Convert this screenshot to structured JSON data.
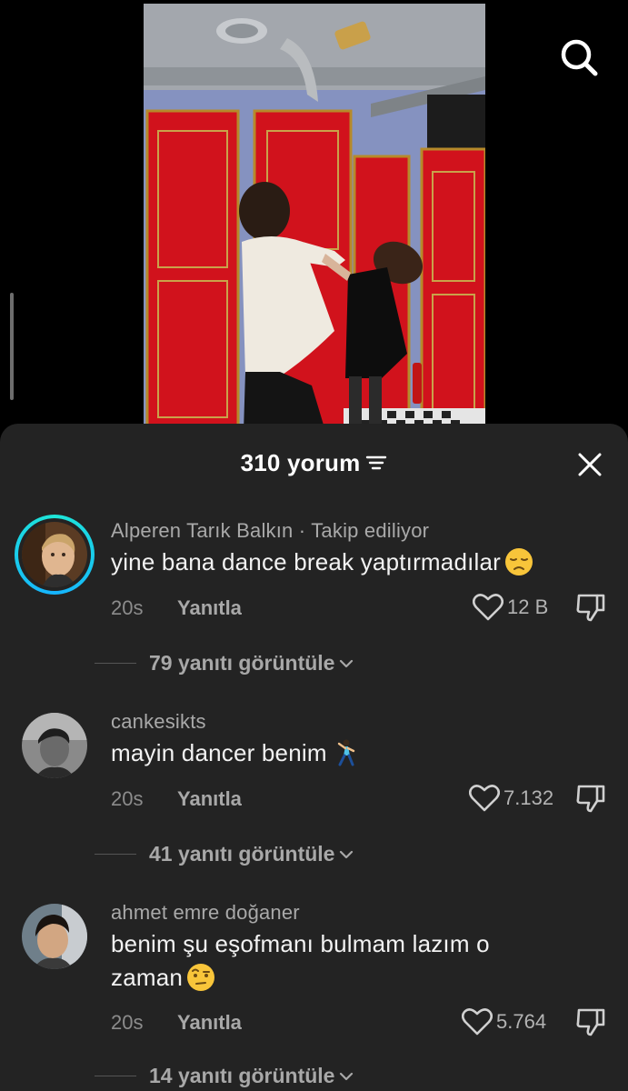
{
  "header": {
    "comment_count": "310 yorum"
  },
  "comments": [
    {
      "username": "Alperen Tarık Balkın · Takip ediliyor",
      "text": "yine bana dance break yaptırmadılar",
      "emoji": "pensive-face-emoji",
      "time": "20s",
      "reply": "Yanıtla",
      "likes": "12 B",
      "view_replies": "79 yanıtı görüntüle"
    },
    {
      "username": "cankesikts",
      "text": "mayin dancer benim",
      "emoji": "dancer-emoji",
      "time": "20s",
      "reply": "Yanıtla",
      "likes": "7.132",
      "view_replies": "41 yanıtı görüntüle"
    },
    {
      "username": "ahmet emre doğaner",
      "text": "benim şu eşofmanı bulmam lazım o zaman",
      "emoji": "face-with-raised-eyebrow-emoji",
      "time": "20s",
      "reply": "Yanıtla",
      "likes": "5.764",
      "view_replies": "14 yanıtı görüntüle"
    }
  ],
  "icons": {
    "search": "search-icon",
    "filter": "filter-icon",
    "close": "close-icon",
    "like": "heart-icon",
    "dislike": "thumbs-down-icon",
    "expand": "chevron-down-icon"
  },
  "colors": {
    "sheet_background": "#232323",
    "story_ring": "#1ee6d7",
    "door_red": "#d1121c",
    "wall_blue": "#8592c0"
  }
}
